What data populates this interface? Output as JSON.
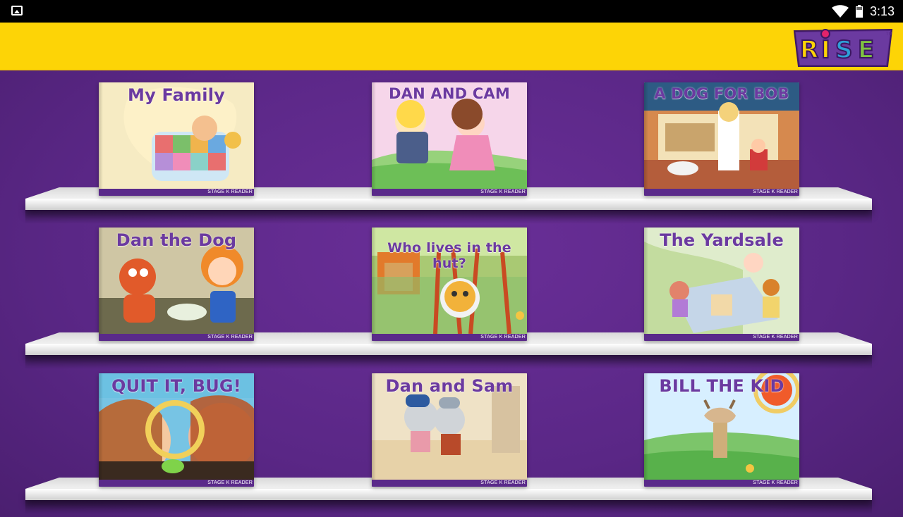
{
  "status_bar": {
    "time": "3:13",
    "left_icon": "image-icon",
    "icons": [
      "wifi-icon",
      "battery-icon"
    ]
  },
  "header": {
    "logo_text": "RISE",
    "trademark": "TM",
    "background": "#fdd406"
  },
  "theme": {
    "bookcase_color": "#5f2b8c",
    "stage_band_color": "#5a2a8a",
    "title_color": "#6b3aa0"
  },
  "shelves": [
    {
      "books": [
        {
          "title": "My Family",
          "stage_label": "STAGE K READER"
        },
        {
          "title": "DAN AND CAM",
          "stage_label": "STAGE K READER"
        },
        {
          "title": "A DOG FOR BOB",
          "stage_label": "STAGE K READER"
        }
      ]
    },
    {
      "books": [
        {
          "title": "Dan the Dog",
          "stage_label": "STAGE K READER"
        },
        {
          "title": "Who lives in the hut?",
          "stage_label": "STAGE K READER"
        },
        {
          "title": "The Yardsale",
          "stage_label": "STAGE K READER"
        }
      ]
    },
    {
      "books": [
        {
          "title": "QUIT IT, BUG!",
          "stage_label": "STAGE K READER"
        },
        {
          "title": "Dan and Sam",
          "stage_label": "STAGE K READER"
        },
        {
          "title": "BILL THE KID",
          "stage_label": "STAGE K READER"
        }
      ]
    }
  ]
}
